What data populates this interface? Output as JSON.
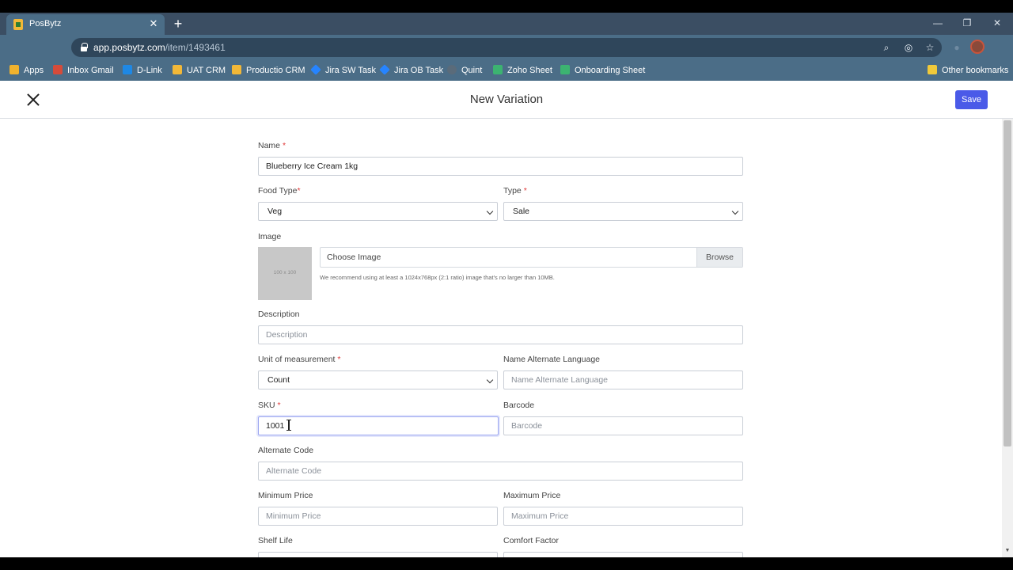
{
  "browser": {
    "tab_title": "PosBytz",
    "url_host": "app.posbytz.com",
    "url_path": "/item/1493461",
    "bookmarks": [
      {
        "label": "Apps",
        "icon": "apps-grid-icon",
        "color": "#f0b22e"
      },
      {
        "label": "Inbox Gmail",
        "icon": "gmail-icon",
        "color": "#d64b3a"
      },
      {
        "label": "D-Link",
        "icon": "dlink-icon",
        "color": "#1e88e5"
      },
      {
        "label": "UAT CRM",
        "icon": "crm-icon",
        "color": "#f2b838"
      },
      {
        "label": "Productio CRM",
        "icon": "crm-icon",
        "color": "#f2b838"
      },
      {
        "label": "Jira SW Task",
        "icon": "jira-icon",
        "color": "#2684ff"
      },
      {
        "label": "Jira OB Task",
        "icon": "jira-icon",
        "color": "#2684ff"
      },
      {
        "label": "Quint",
        "icon": "quint-icon",
        "color": "#5a6b7a"
      },
      {
        "label": "Zoho Sheet",
        "icon": "zoho-sheet-icon",
        "color": "#3cb371"
      },
      {
        "label": "Onboarding Sheet",
        "icon": "zoho-sheet-icon",
        "color": "#3cb371"
      }
    ],
    "other_bookmarks": "Other bookmarks"
  },
  "modal": {
    "title": "New Variation",
    "save_label": "Save"
  },
  "form": {
    "name_label": "Name",
    "name_value": "Blueberry Ice Cream 1kg",
    "food_type_label": "Food Type",
    "food_type_value": "Veg",
    "type_label": "Type",
    "type_value": "Sale",
    "image_label": "Image",
    "image_placeholder_text": "100 x 100",
    "choose_image": "Choose Image",
    "browse": "Browse",
    "image_hint": "We recommend using at least a 1024x768px (2:1 ratio) image that's no larger than 10MB.",
    "description_label": "Description",
    "description_placeholder": "Description",
    "uom_label": "Unit of measurement",
    "uom_value": "Count",
    "alt_lang_label": "Name Alternate Language",
    "alt_lang_placeholder": "Name Alternate Language",
    "sku_label": "SKU",
    "sku_value": "1001",
    "barcode_label": "Barcode",
    "barcode_placeholder": "Barcode",
    "alt_code_label": "Alternate Code",
    "alt_code_placeholder": "Alternate Code",
    "min_price_label": "Minimum Price",
    "min_price_placeholder": "Minimum Price",
    "max_price_label": "Maximum Price",
    "max_price_placeholder": "Maximum Price",
    "shelf_life_label": "Shelf Life",
    "comfort_factor_label": "Comfort Factor",
    "required_mark": "*"
  }
}
